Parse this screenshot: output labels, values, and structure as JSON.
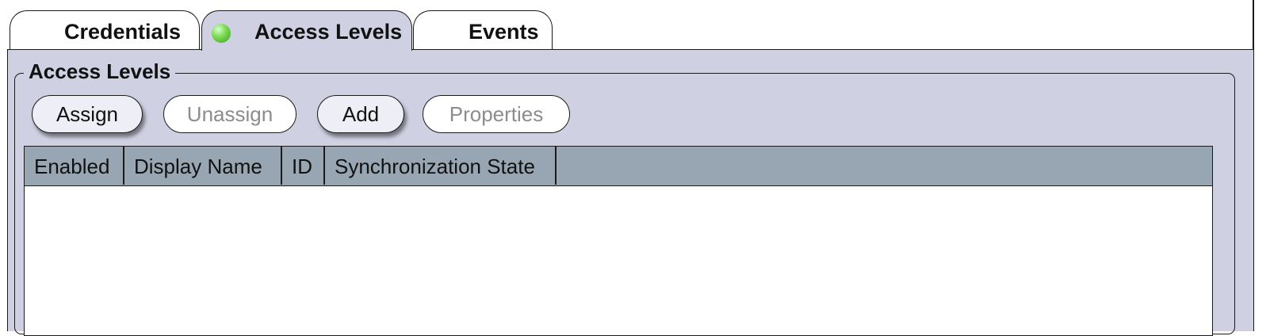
{
  "tabs": [
    {
      "label": "Credentials",
      "active": false
    },
    {
      "label": "Access Levels",
      "active": true,
      "status_color": "#6ecf45"
    },
    {
      "label": "Events",
      "active": false
    }
  ],
  "group": {
    "title": "Access Levels"
  },
  "toolbar": {
    "assign_label": "Assign",
    "unassign_label": "Unassign",
    "add_label": "Add",
    "properties_label": "Properties"
  },
  "table": {
    "columns": [
      "Enabled",
      "Display Name",
      "ID",
      "Synchronization State"
    ],
    "rows": []
  },
  "colors": {
    "panel_background": "#cfd0e2",
    "header_background": "#97a6b2",
    "disabled_text": "#8c8c8c"
  }
}
